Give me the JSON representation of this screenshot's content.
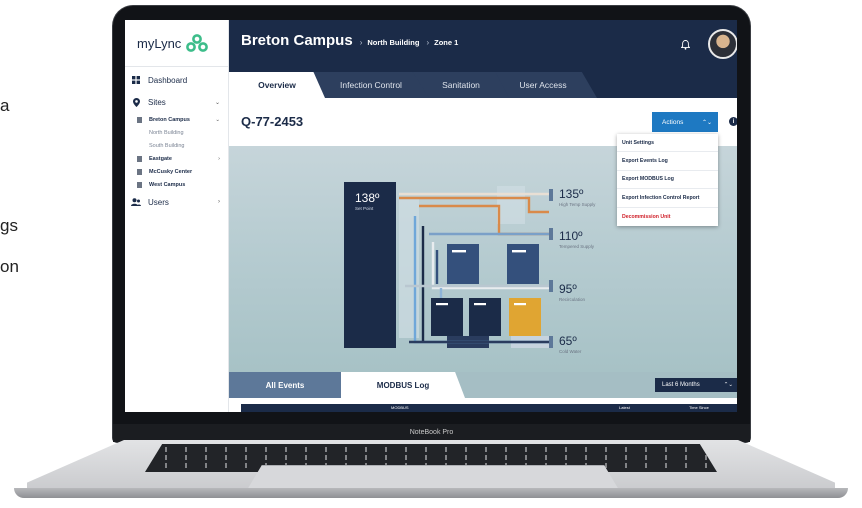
{
  "background_text": [
    "a",
    "gs",
    "on"
  ],
  "device": {
    "model_label": "NoteBook Pro"
  },
  "sidebar": {
    "logo_text": "myLync",
    "items": [
      {
        "label": "Dashboard",
        "icon": "grid-icon"
      },
      {
        "label": "Sites",
        "icon": "map-pin-icon",
        "expanded": true
      },
      {
        "label": "Users",
        "icon": "users-icon"
      }
    ],
    "sites": [
      {
        "label": "Breton Campus",
        "expanded": true,
        "children": [
          "North Building",
          "South Building"
        ]
      },
      {
        "label": "Eastgate",
        "has_children": true
      },
      {
        "label": "McCusky Center"
      },
      {
        "label": "West Campus"
      }
    ]
  },
  "header": {
    "title": "Breton Campus",
    "breadcrumb": [
      "North Building",
      "Zone 1"
    ],
    "bell_icon": "bell-icon"
  },
  "tabs": [
    "Overview",
    "Infection Control",
    "Sanitation",
    "User Access"
  ],
  "active_tab": "Overview",
  "unit": {
    "id": "Q-77-2453"
  },
  "actions": {
    "label": "Actions",
    "menu": [
      "Unit Settings",
      "Export Events Log",
      "Export MODBUS Log",
      "Export Infection Control Report",
      "Decommission Unit"
    ]
  },
  "diagram": {
    "setpoint": {
      "temp": "138º",
      "label": "Set Point"
    },
    "outputs": [
      {
        "temp": "135º",
        "label": "High Temp Supply"
      },
      {
        "temp": "110º",
        "label": "Tempered Supply"
      },
      {
        "temp": "95º",
        "label": "Recirculation"
      },
      {
        "temp": "65º",
        "label": "Cold Water"
      }
    ]
  },
  "bottom": {
    "tabs": [
      "All Events",
      "MODBUS Log"
    ],
    "active_tab": "MODBUS Log",
    "range": "Last 6 Months",
    "log_headers": [
      "MODBUS",
      "Latest",
      "Time Since"
    ]
  },
  "colors": {
    "navy": "#1b2b48",
    "accent": "#1e79c2",
    "danger": "#d0202a",
    "highlight_tank": "#e0a532",
    "logo_green": "#3dbd8a"
  }
}
